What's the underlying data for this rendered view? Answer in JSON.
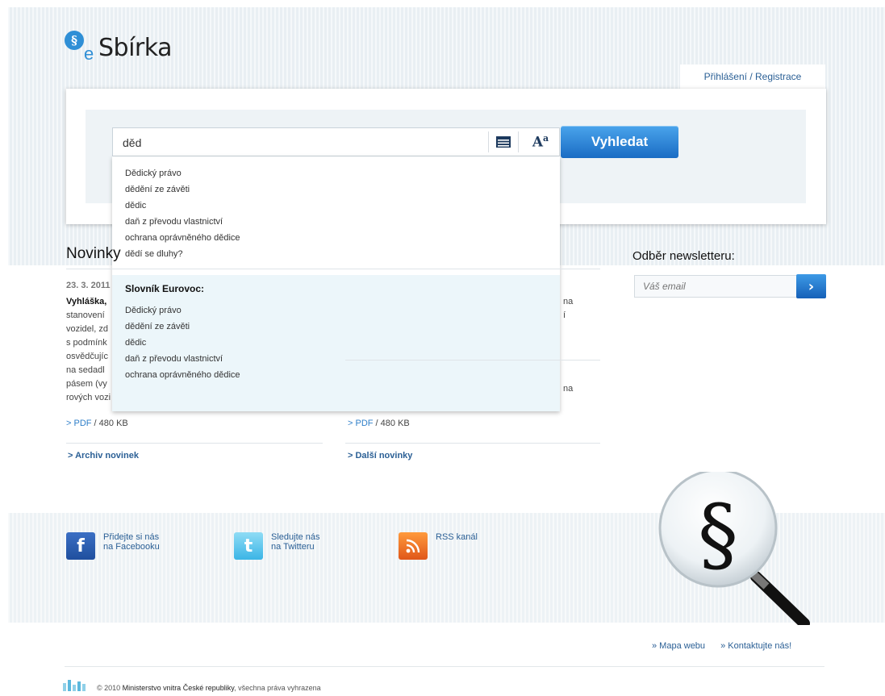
{
  "logo": {
    "brand_mark": "§",
    "brand_e": "e",
    "name": "Sbírka"
  },
  "header": {
    "login_link": "Přihlášení / Registrace"
  },
  "search": {
    "query": "děd",
    "button_label": "Vyhledat",
    "list_icon": "list-icon",
    "font_icon": "font-size-icon",
    "font_label": "A",
    "font_sup": "a",
    "suggestions": [
      "Dědický právo",
      "dědění ze závěti",
      "dědic",
      "daň z převodu vlastnictví",
      "ochrana oprávněného dědice",
      "dědí se dluhy?"
    ],
    "eurovoc_heading": "Slovník Eurovoc:",
    "eurovoc_items": [
      "Dědický právo",
      "dědění ze závěti",
      "dědic",
      "daň z převodu vlastnictví",
      "ochrana oprávněného dědice"
    ]
  },
  "news": {
    "title": "Novinky",
    "date": "23. 3. 2011",
    "lines": [
      "Vyhláška,",
      "stanovení",
      "vozidel, zd",
      "s podmínk",
      "osvědčujíc",
      "na sedadl",
      "pásem (vy",
      "rových vozi"
    ],
    "right_fragment_1": "na",
    "right_fragment_2": "í",
    "right_fragment_3": "na",
    "pdf_label": "> PDF",
    "pdf_size": "/ 480 KB",
    "archive_link": "> Archiv novinek",
    "more_link": "> Další novinky"
  },
  "newsletter": {
    "title": "Odběr newsletteru:",
    "placeholder": "Váš email",
    "submit_icon": "chevron-right-icon"
  },
  "social": {
    "facebook": {
      "line1": "Přidejte si nás",
      "line2": "na Facebooku"
    },
    "twitter": {
      "line1": "Sledujte nás",
      "line2": "na Twitteru"
    },
    "rss": {
      "line1": "RSS kanál"
    }
  },
  "footer": {
    "sitemap": "» Mapa webu",
    "contact": "» Kontaktujte nás!",
    "copyright_prefix": "© 2010",
    "ministry": "Ministerstvo vnitra České republiky",
    "copyright_suffix": ", všechna práva vyhrazena"
  },
  "colors": {
    "accent": "#2f8fd6",
    "link": "#2a5f95",
    "button": "#1a6cc4"
  }
}
